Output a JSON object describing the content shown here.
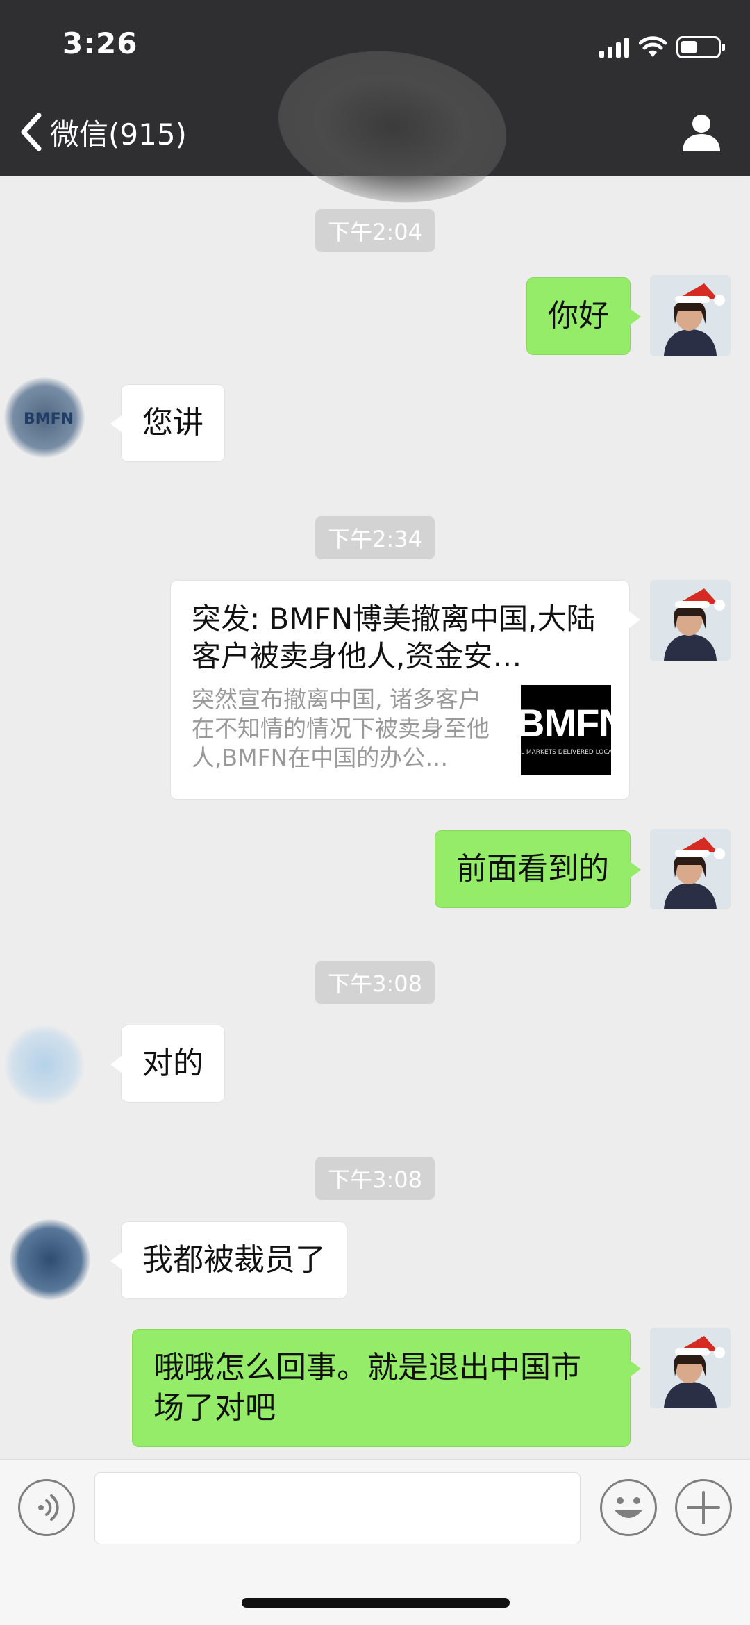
{
  "status_bar": {
    "time": "3:26"
  },
  "header": {
    "back_label": "微信(915)"
  },
  "messages": [
    {
      "kind": "time",
      "text": "下午2:04"
    },
    {
      "kind": "sent",
      "text": "你好"
    },
    {
      "kind": "recv",
      "text": "您讲"
    },
    {
      "kind": "time",
      "text": "下午2:34"
    },
    {
      "kind": "link",
      "title": "突发: BMFN博美撤离中国,大陆客户被卖身他人,资金安…",
      "description": "突然宣布撤离中国, 诸多客户在不知情的情况下被卖身至他人,BMFN在中国的办公…",
      "thumb_text": "BMFN",
      "thumb_subtext": "L MARKETS DELIVERED LOCA"
    },
    {
      "kind": "sent",
      "text": "前面看到的"
    },
    {
      "kind": "time",
      "text": "下午3:08"
    },
    {
      "kind": "recv",
      "text": "对的"
    },
    {
      "kind": "time",
      "text": "下午3:08"
    },
    {
      "kind": "recv",
      "text": "我都被裁员了"
    },
    {
      "kind": "sent",
      "text": "哦哦怎么回事。就是退出中国市场了对吧"
    }
  ],
  "avatars": {
    "peer_logo_text": "BMFN"
  },
  "input_bar": {
    "value": ""
  },
  "colors": {
    "header_bg": "#2f2f31",
    "chat_bg": "#ededed",
    "sent_bubble": "#95ec69",
    "recv_bubble": "#ffffff"
  },
  "icons": [
    "back-chevron-icon",
    "person-icon",
    "voice-icon",
    "emoji-icon",
    "plus-icon",
    "signal-icon",
    "wifi-icon",
    "battery-icon"
  ]
}
